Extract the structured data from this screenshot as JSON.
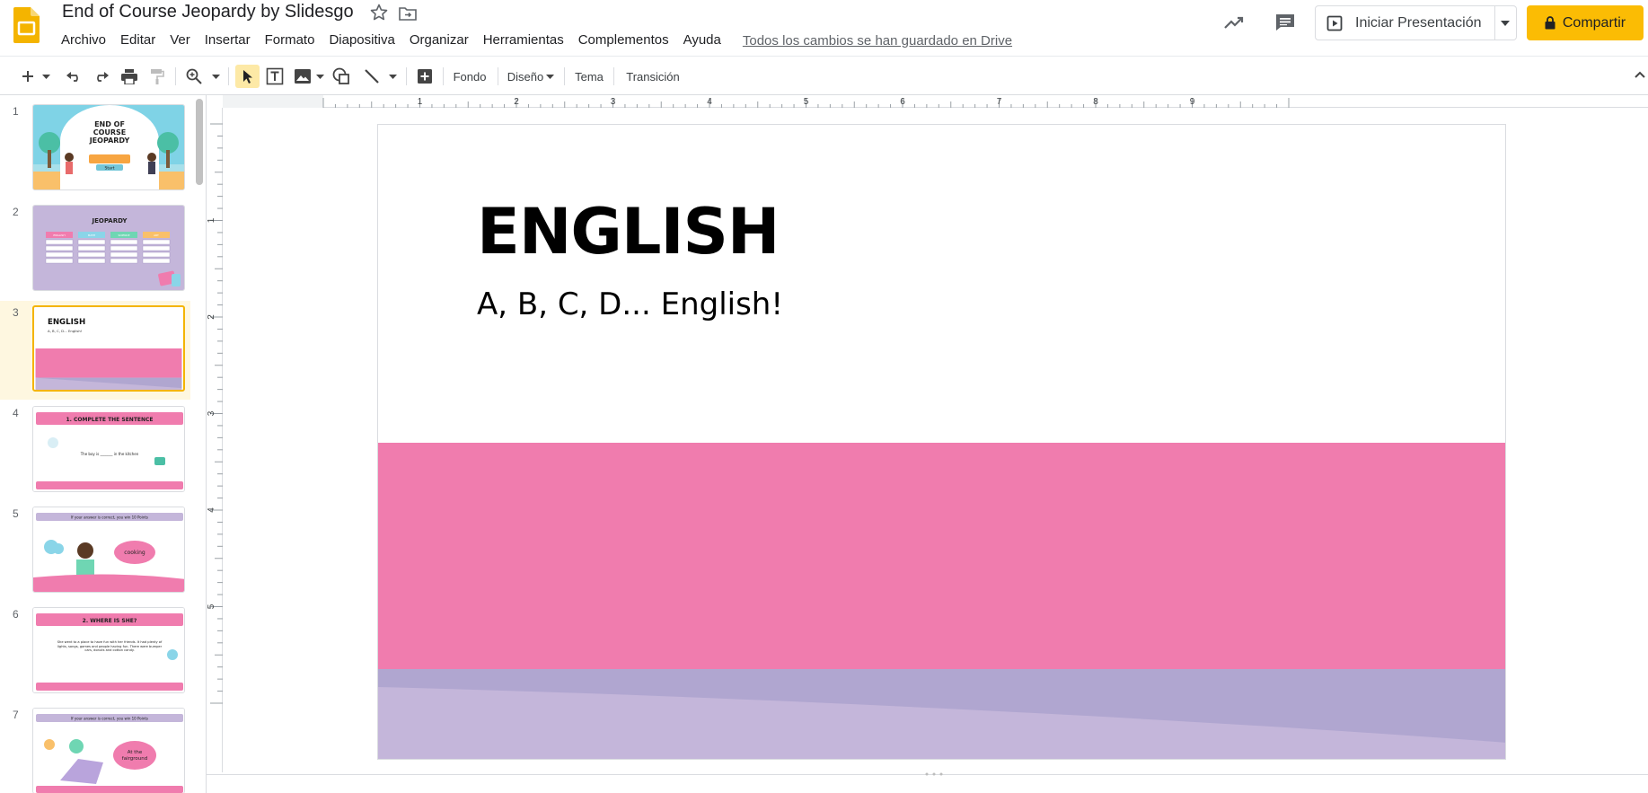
{
  "app": {
    "title": "End of Course Jeopardy by Slidesgo",
    "save_status": "Todos los cambios se han guardado en Drive",
    "brand_color": "#fbbc04"
  },
  "menu": [
    "Archivo",
    "Editar",
    "Ver",
    "Insertar",
    "Formato",
    "Diapositiva",
    "Organizar",
    "Herramientas",
    "Complementos",
    "Ayuda"
  ],
  "header_buttons": {
    "present_label": "Iniciar Presentación",
    "share_label": "Compartir"
  },
  "toolbar": {
    "background_label": "Fondo",
    "layout_label": "Diseño",
    "theme_label": "Tema",
    "transition_label": "Transición"
  },
  "filmstrip": {
    "selected_index": 3,
    "slides": [
      {
        "number": "1",
        "title": "END OF COURSE JEOPARDY",
        "button": "Start"
      },
      {
        "number": "2",
        "title": "JEOPARDY",
        "columns": [
          "ENGLISH",
          "MATH",
          "SCIENCE",
          "ART"
        ]
      },
      {
        "number": "3",
        "title": "ENGLISH",
        "subtitle": "A, B, C, D... English!"
      },
      {
        "number": "4",
        "title": "1. COMPLETE THE SENTENCE",
        "body": "The boy is _______ in the kitchen"
      },
      {
        "number": "5",
        "title": "If your answer is correct, you win 10 Points",
        "bubble": "cooking"
      },
      {
        "number": "6",
        "title": "2. WHERE IS SHE?",
        "body": "She went to a place to have fun with her friends. It had plenty of lights, songs, games and people having fun. There were bumper cars, donuts and cotton candy."
      },
      {
        "number": "7",
        "title": "If your answer is correct, you win 10 Points",
        "bubble": "At the fairground"
      }
    ]
  },
  "ruler": {
    "top": [
      "1",
      "2",
      "3",
      "4",
      "5",
      "6",
      "7",
      "8",
      "9"
    ],
    "left": [
      "1",
      "2",
      "3",
      "4",
      "5"
    ]
  },
  "slide": {
    "title": "ENGLISH",
    "subtitle": "A, B, C, D... English!",
    "pink": "#f07cae",
    "lilac_light": "#c4b6da",
    "lilac_dark": "#b0a6d0"
  }
}
